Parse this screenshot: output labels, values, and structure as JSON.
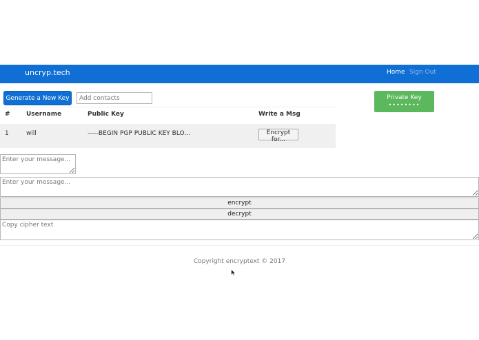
{
  "navbar": {
    "brand": "uncryp.tech",
    "home": "Home",
    "sign_out": "Sign Out"
  },
  "toolbar": {
    "generate_label": "Generate a New Key",
    "contacts_placeholder": "Add contacts"
  },
  "private_key": {
    "label": "Private Key",
    "masked": "••••••••"
  },
  "table": {
    "headers": [
      "#",
      "Username",
      "Public Key",
      "Write a Msg"
    ],
    "rows": [
      {
        "num": "1",
        "username": "will",
        "public_key": "-----BEGIN PGP PUBLIC KEY BLO…",
        "action": "Encrypt for..."
      }
    ]
  },
  "composer": {
    "message_placeholder": "Enter your message...",
    "message_placeholder_wide": "Enter your message...",
    "encrypt_label": "encrypt",
    "decrypt_label": "decrypt",
    "cipher_placeholder": "Copy cipher text"
  },
  "footer": {
    "copyright": "Copyright encryptext © 2017"
  },
  "colors": {
    "primary": "#0f6fd4",
    "success": "#5cb85c",
    "row_stripe": "#f0f0f0"
  }
}
